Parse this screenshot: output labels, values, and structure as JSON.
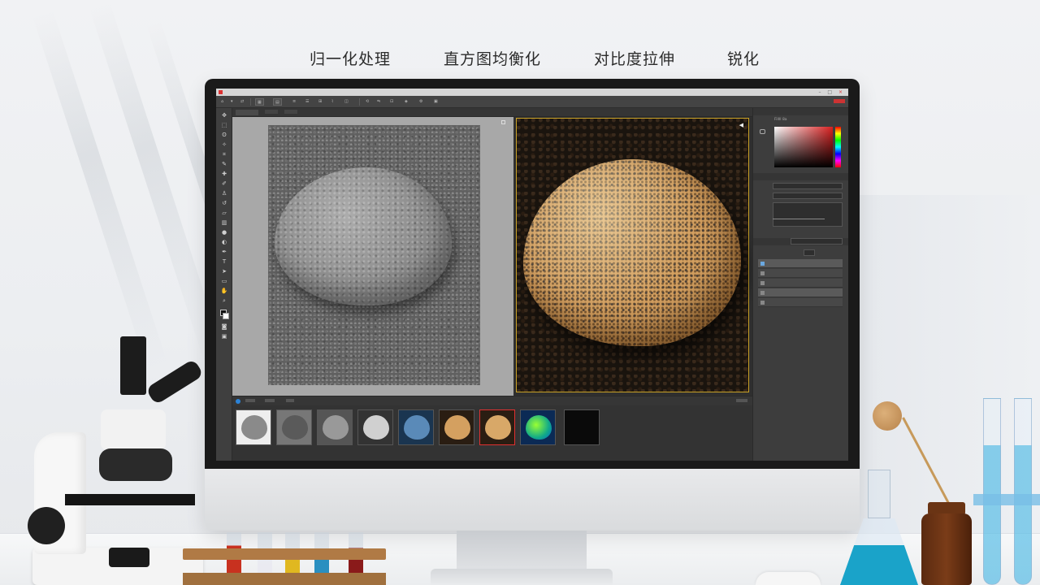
{
  "headings": {
    "step1": "归一化处理",
    "step2": "直方图均衡化",
    "step3": "对比度拉伸",
    "step4": "锐化"
  },
  "colors": {
    "accent_red": "#e03030",
    "selection_gold": "#c9a227",
    "ui_dark": "#3b3b3b",
    "cyan_liquid": "#1aa3c9"
  },
  "toolbox": {
    "icons": [
      "move-icon",
      "marquee-icon",
      "lasso-icon",
      "magic-wand-icon",
      "crop-icon",
      "eyedropper-icon",
      "healing-icon",
      "brush-icon",
      "stamp-icon",
      "history-brush-icon",
      "eraser-icon",
      "gradient-icon",
      "blur-icon",
      "dodge-icon",
      "pen-icon",
      "type-icon",
      "path-select-icon",
      "shape-icon",
      "hand-icon",
      "zoom-icon"
    ]
  },
  "right_panel": {
    "color_value": "Fillll 8a"
  },
  "layers": {
    "items": [
      {
        "icon": "layer-icon"
      },
      {
        "icon": "layer-icon"
      },
      {
        "icon": "layer-icon"
      },
      {
        "icon": "layer-icon"
      },
      {
        "icon": "layer-icon"
      }
    ]
  },
  "filmstrip": {
    "thumbs": [
      {
        "style": "white-gray"
      },
      {
        "style": "dark-gray"
      },
      {
        "style": "gray"
      },
      {
        "style": "contrast-gray"
      },
      {
        "style": "blue-tint"
      },
      {
        "style": "warm"
      },
      {
        "style": "warm",
        "selected": true
      },
      {
        "style": "false-color"
      },
      {
        "style": "black"
      }
    ]
  }
}
